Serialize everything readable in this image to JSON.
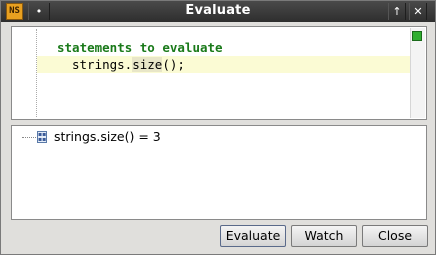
{
  "window": {
    "title": "Evaluate",
    "app_icon_text": "NS",
    "menu_glyph": "•",
    "maximize_glyph": "↑",
    "close_glyph": "✕"
  },
  "editor": {
    "comment_line": "statements to evaluate",
    "code_prefix": "strings.",
    "code_highlight": "size",
    "code_suffix": "();",
    "status_color": "#2fae2f"
  },
  "results": {
    "items": [
      {
        "text": "strings.size() = 3"
      }
    ]
  },
  "buttons": {
    "evaluate": "Evaluate",
    "watch": "Watch",
    "close": "Close"
  }
}
